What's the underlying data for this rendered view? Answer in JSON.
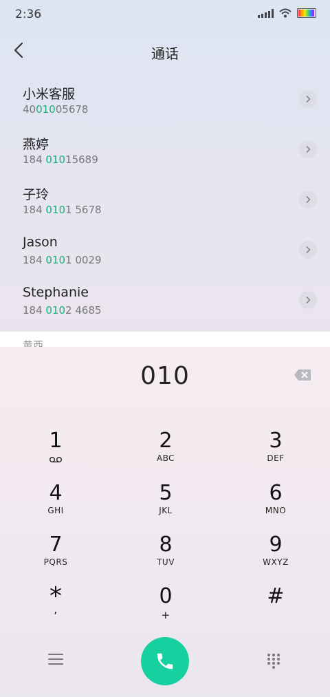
{
  "status_bar": {
    "time": "2:36"
  },
  "header": {
    "title": "通话",
    "back_icon": "chevron-left-icon"
  },
  "contacts": [
    {
      "name": "小米客服",
      "number_pre": "40",
      "number_match": "010",
      "number_post": "05678"
    },
    {
      "name": "燕婷",
      "number_pre": "184 ",
      "number_match": "010",
      "number_post": "15689"
    },
    {
      "name": "子玲",
      "number_pre": "184 ",
      "number_match": "010",
      "number_post": "1 5678"
    },
    {
      "name": "Jason",
      "number_pre": "184 ",
      "number_match": "010",
      "number_post": "1 0029"
    },
    {
      "name": "Stephanie",
      "number_pre": "184 ",
      "number_match": "010",
      "number_post": "2 4685"
    }
  ],
  "partial_contact": {
    "name": "黄西"
  },
  "dialer": {
    "display_value": "010",
    "keys": [
      {
        "digit": "1",
        "letters": ""
      },
      {
        "digit": "2",
        "letters": "ABC"
      },
      {
        "digit": "3",
        "letters": "DEF"
      },
      {
        "digit": "4",
        "letters": "GHI"
      },
      {
        "digit": "5",
        "letters": "JKL"
      },
      {
        "digit": "6",
        "letters": "MNO"
      },
      {
        "digit": "7",
        "letters": "PQRS"
      },
      {
        "digit": "8",
        "letters": "TUV"
      },
      {
        "digit": "9",
        "letters": "WXYZ"
      },
      {
        "digit": "*",
        "letters": ","
      },
      {
        "digit": "0",
        "letters": "+"
      },
      {
        "digit": "#",
        "letters": ""
      }
    ]
  },
  "colors": {
    "match_highlight": "#17b07a",
    "call_button": "#16d0a0"
  },
  "icons": [
    "chevron-left-icon",
    "chevron-right-icon",
    "backspace-icon",
    "voicemail-icon",
    "menu-icon",
    "phone-icon",
    "dialpad-icon",
    "signal-icon",
    "wifi-icon",
    "battery-icon"
  ]
}
